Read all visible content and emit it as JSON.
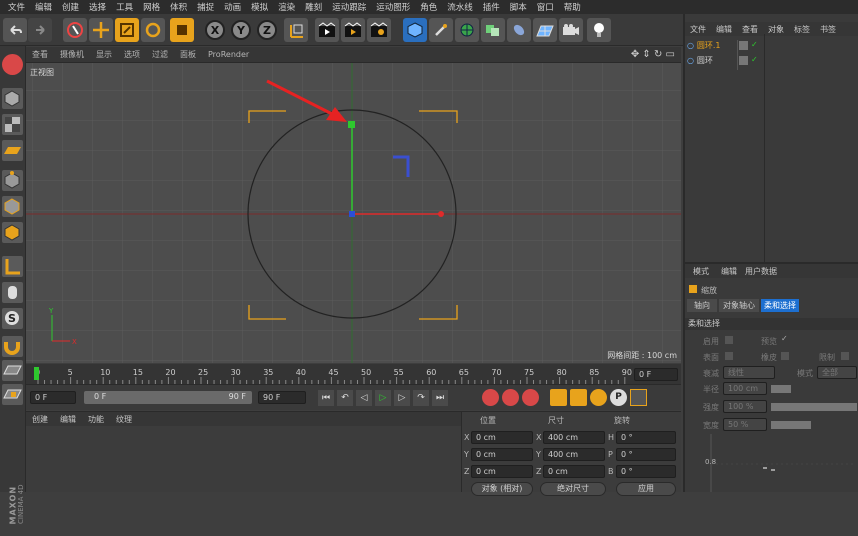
{
  "menubar": [
    "文件",
    "编辑",
    "创建",
    "选择",
    "工具",
    "网格",
    "体积",
    "捕捉",
    "动画",
    "模拟",
    "渲染",
    "雕刻",
    "运动跟踪",
    "运动图形",
    "角色",
    "流水线",
    "插件",
    "脚本",
    "窗口",
    "帮助"
  ],
  "viewport": {
    "tabs": [
      "查看",
      "摄像机",
      "显示",
      "选项",
      "过滤",
      "面板",
      "ProRender"
    ],
    "view_name": "正视图",
    "grid_label": "网格间距 : 100 cm"
  },
  "timeline": {
    "ticks": [
      "0",
      "5",
      "10",
      "15",
      "20",
      "25",
      "30",
      "35",
      "40",
      "45",
      "50",
      "55",
      "60",
      "65",
      "70",
      "75",
      "80",
      "85",
      "90"
    ],
    "frame_field": "0 F"
  },
  "transport": {
    "start": "0 F",
    "slider": "0 F",
    "slider_end": "90 F",
    "end": "90 F"
  },
  "material_manager": {
    "tabs": [
      "创建",
      "编辑",
      "功能",
      "纹理"
    ]
  },
  "coordinates": {
    "headers": [
      "位置",
      "尺寸",
      "旋转"
    ],
    "rows": [
      {
        "axis": "X",
        "pos": "0 cm",
        "size_axis": "X",
        "size": "400 cm",
        "rot_axis": "H",
        "rot": "0 °"
      },
      {
        "axis": "Y",
        "pos": "0 cm",
        "size_axis": "Y",
        "size": "400 cm",
        "rot_axis": "P",
        "rot": "0 °"
      },
      {
        "axis": "Z",
        "pos": "0 cm",
        "size_axis": "Z",
        "size": "0 cm",
        "rot_axis": "B",
        "rot": "0 °"
      }
    ],
    "mode1": "对象 (相对)",
    "mode2": "绝对尺寸",
    "apply": "应用"
  },
  "object_manager": {
    "menu": [
      "文件",
      "编辑",
      "查看",
      "对象",
      "标签",
      "书签"
    ],
    "objects": [
      "圆环.1",
      "圆环"
    ]
  },
  "attribute_manager": {
    "menu": [
      "模式",
      "编辑",
      "用户数据"
    ],
    "title": "缩放",
    "tabs": [
      "轴向",
      "对象轴心",
      "柔和选择"
    ],
    "section": "柔和选择",
    "rows": [
      {
        "label": "启用",
        "label2": "预览"
      },
      {
        "label": "表面",
        "label2": "橡皮",
        "label3": "限制"
      },
      {
        "label": "衰减",
        "value": "线性",
        "label2": "模式",
        "value2": "全部"
      },
      {
        "label": "半径",
        "value": "100 cm"
      },
      {
        "label": "强度",
        "value": "100 %"
      },
      {
        "label": "宽度",
        "value": "50 %"
      }
    ],
    "curve_label": "0.8"
  },
  "branding": {
    "line1": "MAXON",
    "line2": "CINEMA 4D"
  },
  "colors": {
    "accent": "#e8a31c",
    "selected_tab": "#1d6fd0",
    "y_axis": "#2ec92e",
    "x_axis": "#e02b2b"
  }
}
